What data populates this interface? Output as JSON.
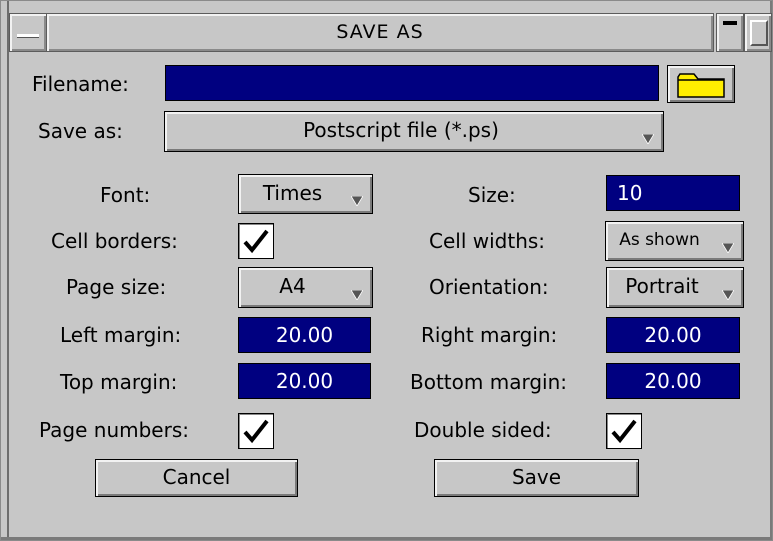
{
  "window": {
    "title": "SAVE AS"
  },
  "filename": {
    "label": "Filename:",
    "value": ""
  },
  "save_as": {
    "label": "Save as:",
    "value": "Postscript file (*.ps)"
  },
  "font": {
    "label": "Font:",
    "value": "Times"
  },
  "size": {
    "label": "Size:",
    "value": "10"
  },
  "cell_borders": {
    "label": "Cell borders:",
    "checked": true
  },
  "cell_widths": {
    "label": "Cell widths:",
    "value": "As shown"
  },
  "page_size": {
    "label": "Page size:",
    "value": "A4"
  },
  "orientation": {
    "label": "Orientation:",
    "value": "Portrait"
  },
  "left_margin": {
    "label": "Left margin:",
    "value": "20.00"
  },
  "right_margin": {
    "label": "Right margin:",
    "value": "20.00"
  },
  "top_margin": {
    "label": "Top margin:",
    "value": "20.00"
  },
  "bottom_margin": {
    "label": "Bottom margin:",
    "value": "20.00"
  },
  "page_numbers": {
    "label": "Page numbers:",
    "checked": true
  },
  "double_sided": {
    "label": "Double sided:",
    "checked": true
  },
  "buttons": {
    "cancel": "Cancel",
    "save": "Save"
  },
  "icons": {
    "folder": "folder-icon",
    "dropdown": "dropdown-arrow-icon",
    "check": "checkmark-icon"
  },
  "colors": {
    "field_bg": "#000080",
    "folder": "#ffee00",
    "window_bg": "#c7c7c7"
  }
}
